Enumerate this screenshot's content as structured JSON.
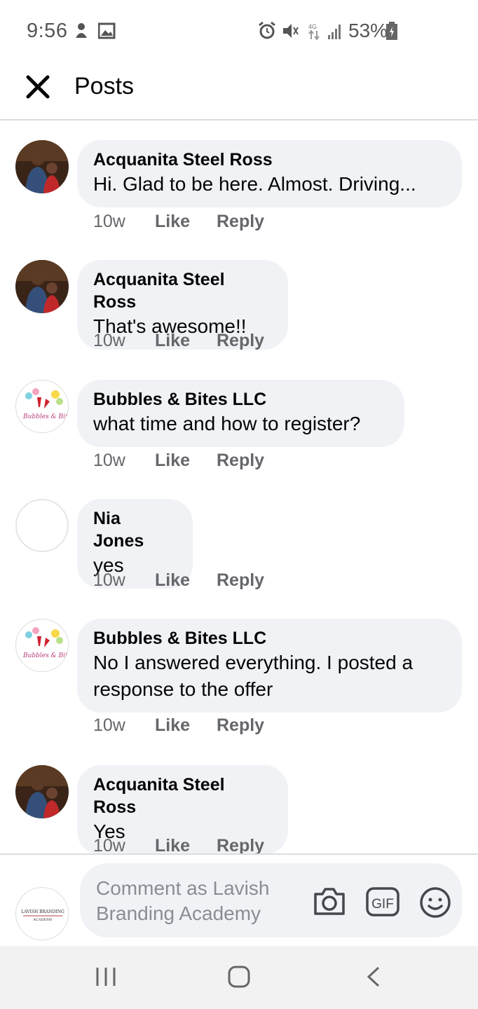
{
  "status_bar": {
    "time": "9:56",
    "battery": "53%",
    "icons": [
      "notification-icon",
      "image-icon",
      "alarm-icon",
      "vibrate-icon",
      "lte-icon",
      "signal-icon",
      "battery-icon"
    ]
  },
  "header": {
    "title": "Posts",
    "close_icon": "close-icon"
  },
  "comments": [
    {
      "author": "Acquanita Steel Ross",
      "text": "Hi. Glad to be here. Almost.  Driving...",
      "time": "10w",
      "like": "Like",
      "reply": "Reply",
      "avatar": "photo"
    },
    {
      "author": "Acquanita Steel Ross",
      "text": "That's awesome!!",
      "time": "10w",
      "like": "Like",
      "reply": "Reply",
      "avatar": "photo"
    },
    {
      "author": "Bubbles & Bites LLC",
      "text": "what time and how to register?",
      "time": "10w",
      "like": "Like",
      "reply": "Reply",
      "avatar": "logo"
    },
    {
      "author": "Nia Jones",
      "text": "yes",
      "time": "10w",
      "like": "Like",
      "reply": "Reply",
      "avatar": "empty"
    },
    {
      "author": "Bubbles & Bites LLC",
      "text_lines": [
        "No I answered everything.  I posted a",
        "response to the offer"
      ],
      "time": "10w",
      "like": "Like",
      "reply": "Reply",
      "avatar": "logo"
    },
    {
      "author": "Acquanita Steel Ross",
      "text": "Yes",
      "time": "10w",
      "like": "Like",
      "reply": "Reply",
      "avatar": "photo"
    }
  ],
  "composer": {
    "placeholder_line1": "Comment as Lavish",
    "placeholder_line2": "Branding Academy",
    "avatar_line1": "LAVISH BRANDING",
    "avatar_line2": "ACADEMY",
    "camera_icon": "camera-icon",
    "gif_label": "GIF",
    "emoji_icon": "emoji-icon"
  },
  "navbar": [
    "recent-apps-icon",
    "home-icon",
    "back-icon"
  ],
  "colors": {
    "bubble": "#f0f2f5",
    "meta_text": "#65676b",
    "primary_text": "#050505",
    "placeholder": "#8a8d91"
  }
}
